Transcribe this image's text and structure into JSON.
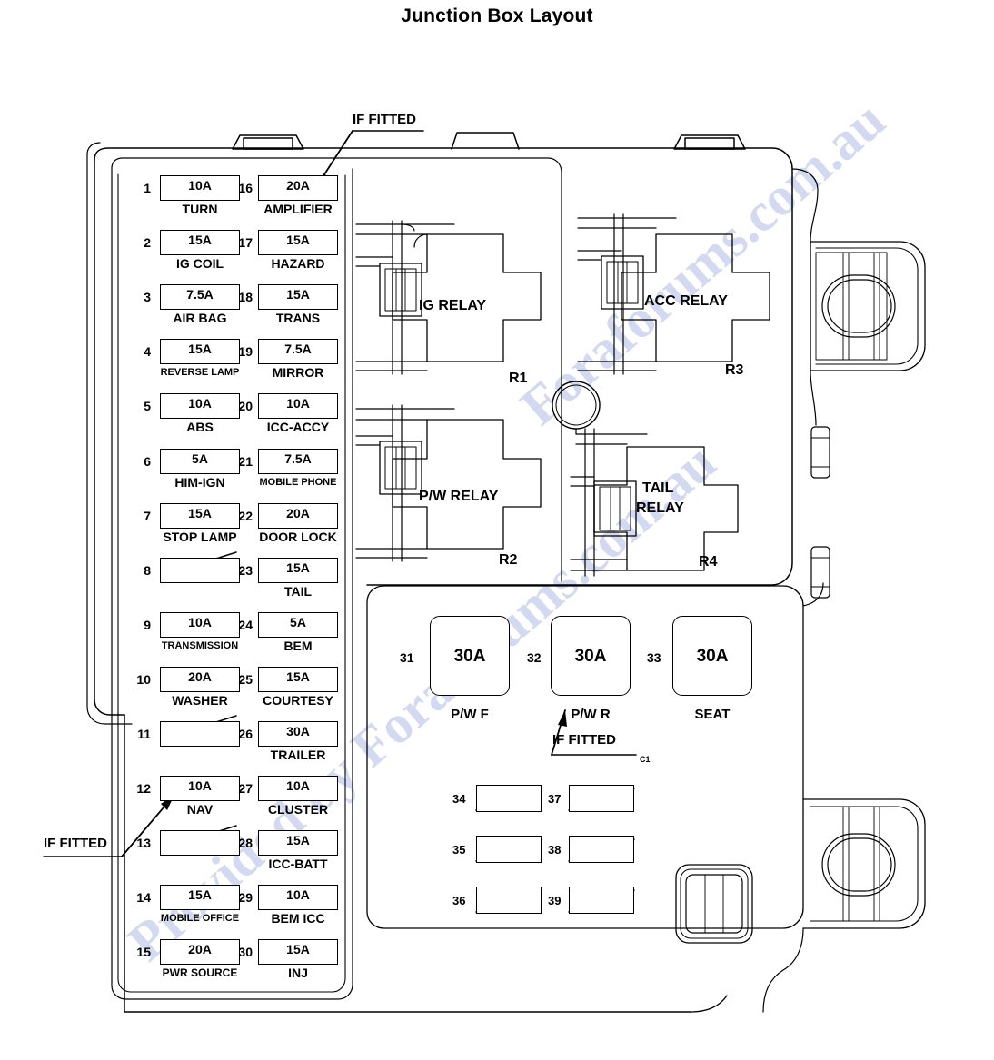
{
  "page": {
    "title": "Junction Box Layout",
    "watermark_line_1": "Provided by Foraforums.com.au",
    "watermark_line_2": "Foraforums.com.au"
  },
  "fuse_panel": {
    "left_column": [
      {
        "num": "1",
        "rating": "10A",
        "label": "TURN"
      },
      {
        "num": "2",
        "rating": "15A",
        "label": "IG COIL"
      },
      {
        "num": "3",
        "rating": "7.5A",
        "label": "AIR BAG"
      },
      {
        "num": "4",
        "rating": "15A",
        "label": "REVERSE LAMP"
      },
      {
        "num": "5",
        "rating": "10A",
        "label": "ABS"
      },
      {
        "num": "6",
        "rating": "5A",
        "label": "HIM-IGN"
      },
      {
        "num": "7",
        "rating": "15A",
        "label": "STOP LAMP"
      },
      {
        "num": "8",
        "rating": "",
        "label": ""
      },
      {
        "num": "9",
        "rating": "10A",
        "label": "TRANSMISSION"
      },
      {
        "num": "10",
        "rating": "20A",
        "label": "WASHER"
      },
      {
        "num": "11",
        "rating": "",
        "label": ""
      },
      {
        "num": "12",
        "rating": "10A",
        "label": "NAV"
      },
      {
        "num": "13",
        "rating": "",
        "label": ""
      },
      {
        "num": "14",
        "rating": "15A",
        "label": "MOBILE OFFICE"
      },
      {
        "num": "15",
        "rating": "20A",
        "label": "PWR SOURCE"
      }
    ],
    "right_column": [
      {
        "num": "16",
        "rating": "20A",
        "label": "AMPLIFIER"
      },
      {
        "num": "17",
        "rating": "15A",
        "label": "HAZARD"
      },
      {
        "num": "18",
        "rating": "15A",
        "label": "TRANS"
      },
      {
        "num": "19",
        "rating": "7.5A",
        "label": "MIRROR"
      },
      {
        "num": "20",
        "rating": "10A",
        "label": "ICC-ACCY"
      },
      {
        "num": "21",
        "rating": "7.5A",
        "label": "MOBILE PHONE"
      },
      {
        "num": "22",
        "rating": "20A",
        "label": "DOOR LOCK"
      },
      {
        "num": "23",
        "rating": "15A",
        "label": "TAIL"
      },
      {
        "num": "24",
        "rating": "5A",
        "label": "BEM"
      },
      {
        "num": "25",
        "rating": "15A",
        "label": "COURTESY"
      },
      {
        "num": "26",
        "rating": "30A",
        "label": "TRAILER"
      },
      {
        "num": "27",
        "rating": "10A",
        "label": "CLUSTER"
      },
      {
        "num": "28",
        "rating": "15A",
        "label": "ICC-BATT"
      },
      {
        "num": "29",
        "rating": "10A",
        "label": "BEM ICC"
      },
      {
        "num": "30",
        "rating": "15A",
        "label": "INJ"
      }
    ]
  },
  "relays": [
    {
      "name": "IG RELAY",
      "id": "R1"
    },
    {
      "name": "ACC RELAY",
      "id": "R3"
    },
    {
      "name": "P/W RELAY",
      "id": "R2"
    },
    {
      "name": "TAIL RELAY_line1",
      "id": "R4"
    }
  ],
  "relay_labels": {
    "ig": "IG RELAY",
    "acc": "ACC RELAY",
    "pw": "P/W RELAY",
    "tail_line1": "TAIL",
    "tail_line2": "RELAY",
    "r1": "R1",
    "r2": "R2",
    "r3": "R3",
    "r4": "R4"
  },
  "high_current_fuses": [
    {
      "num": "31",
      "rating": "30A",
      "label": "P/W F"
    },
    {
      "num": "32",
      "rating": "30A",
      "label": "P/W R"
    },
    {
      "num": "33",
      "rating": "30A",
      "label": "SEAT"
    }
  ],
  "spare_slots": [
    {
      "num": "34"
    },
    {
      "num": "37"
    },
    {
      "num": "35"
    },
    {
      "num": "38"
    },
    {
      "num": "36"
    },
    {
      "num": "39"
    }
  ],
  "callouts": {
    "if_fitted_top": "IF FITTED",
    "if_fitted_left": "IF FITTED",
    "if_fitted_pwr": "IF FITTED",
    "connector_c1": "C1"
  }
}
